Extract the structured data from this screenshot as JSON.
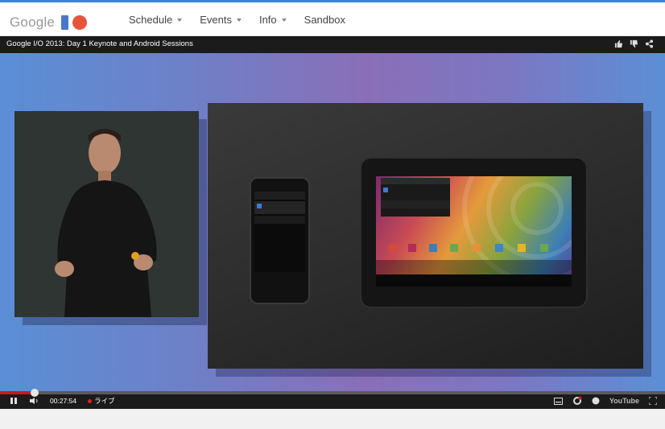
{
  "header": {
    "logo_text": "Google",
    "nav": [
      {
        "label": "Schedule"
      },
      {
        "label": "Events"
      },
      {
        "label": "Info"
      },
      {
        "label": "Sandbox"
      }
    ]
  },
  "player": {
    "title": "Google I/O 2013: Day 1 Keynote and Android Sessions",
    "time": "00:27:54",
    "live_label": "ライブ",
    "progress_fraction": 0.052,
    "brand": "YouTube",
    "accent": "#cc181e"
  },
  "icons": {
    "like": "thumbs-up-icon",
    "dislike": "thumbs-down-icon",
    "share": "share-icon",
    "pause": "pause-icon",
    "volume": "volume-icon",
    "captions": "captions-icon",
    "settings": "gear-icon",
    "info": "info-icon",
    "fullscreen": "fullscreen-icon"
  }
}
